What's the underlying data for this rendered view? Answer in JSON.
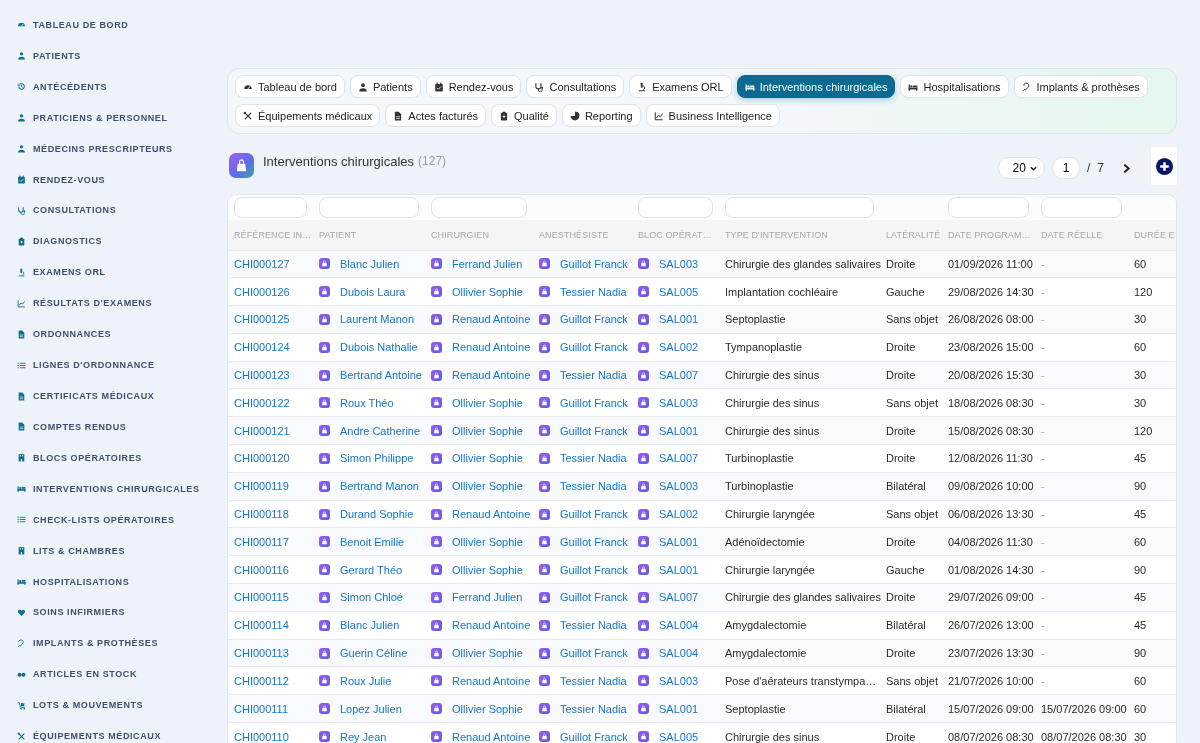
{
  "sidebar": {
    "items": [
      {
        "label": "TABLEAU DE BORD"
      },
      {
        "label": "PATIENTS"
      },
      {
        "label": "ANTÉCÉDENTS"
      },
      {
        "label": "PRATICIENS & PERSONNEL"
      },
      {
        "label": "MÉDECINS PRESCRIPTEURS"
      },
      {
        "label": "RENDEZ-VOUS"
      },
      {
        "label": "CONSULTATIONS"
      },
      {
        "label": "DIAGNOSTICS"
      },
      {
        "label": "EXAMENS ORL"
      },
      {
        "label": "RÉSULTATS D'EXAMENS"
      },
      {
        "label": "ORDONNANCES"
      },
      {
        "label": "LIGNES D'ORDONNANCE"
      },
      {
        "label": "CERTIFICATS MÉDICAUX"
      },
      {
        "label": "COMPTES RENDUS"
      },
      {
        "label": "BLOCS OPÉRATOIRES"
      },
      {
        "label": "INTERVENTIONS CHIRURGICALES"
      },
      {
        "label": "CHECK-LISTS OPÉRATOIRES"
      },
      {
        "label": "LITS & CHAMBRES"
      },
      {
        "label": "HOSPITALISATIONS"
      },
      {
        "label": "SOINS INFIRMIERS"
      },
      {
        "label": "IMPLANTS & PROTHÈSES"
      },
      {
        "label": "ARTICLES EN STOCK"
      },
      {
        "label": "LOTS & MOUVEMENTS"
      },
      {
        "label": "ÉQUIPEMENTS MÉDICAUX"
      }
    ]
  },
  "tabs": [
    {
      "label": "Tableau de bord",
      "selected": false
    },
    {
      "label": "Patients",
      "selected": false
    },
    {
      "label": "Rendez-vous",
      "selected": false
    },
    {
      "label": "Consultations",
      "selected": false
    },
    {
      "label": "Examens ORL",
      "selected": false
    },
    {
      "label": "Interventions chirurgicales",
      "selected": true
    },
    {
      "label": "Hospitalisations",
      "selected": false
    },
    {
      "label": "Implants & prothèses",
      "selected": false
    },
    {
      "label": "Équipements médicaux",
      "selected": false
    },
    {
      "label": "Actes facturés",
      "selected": false
    },
    {
      "label": "Qualité",
      "selected": false
    },
    {
      "label": "Reporting",
      "selected": false
    },
    {
      "label": "Business Intelligence",
      "selected": false
    }
  ],
  "header": {
    "title": "Interventions chirurgicales",
    "count": "(127)"
  },
  "pagination": {
    "page_size": "20",
    "page": "1",
    "separator": "/",
    "total_pages": "7"
  },
  "table": {
    "columns": [
      {
        "label": "RÉFÉRENCE IN…",
        "kind": "ref",
        "filter": true
      },
      {
        "label": "PATIENT",
        "kind": "person",
        "filter": true
      },
      {
        "label": "CHIRURGIEN",
        "kind": "person",
        "filter": true
      },
      {
        "label": "ANESTHÉSISTE",
        "kind": "person",
        "filter": false
      },
      {
        "label": "BLOC OPÉRAT…",
        "kind": "person",
        "filter": true
      },
      {
        "label": "TYPE D'INTERVENTION",
        "kind": "text",
        "filter": true
      },
      {
        "label": "LATÉRALITÉ",
        "kind": "text",
        "filter": false
      },
      {
        "label": "DATE PROGRAM…",
        "kind": "text",
        "filter": true
      },
      {
        "label": "DATE RÉELLE",
        "kind": "date",
        "filter": true
      },
      {
        "label": "DURÉE E",
        "kind": "text",
        "filter": false
      }
    ],
    "rows": [
      [
        "CHI000127",
        "Blanc Julien",
        "Ferrand Julien",
        "Guillot Franck",
        "SAL003",
        "Chirurgie des glandes salivaires",
        "Droite",
        "01/09/2026 11:00",
        "-",
        "60"
      ],
      [
        "CHI000126",
        "Dubois Laura",
        "Ollivier Sophie",
        "Tessier Nadia",
        "SAL005",
        "Implantation cochléaire",
        "Gauche",
        "29/08/2026 14:30",
        "-",
        "120"
      ],
      [
        "CHI000125",
        "Laurent Manon",
        "Renaud Antoine",
        "Guillot Franck",
        "SAL001",
        "Septoplastie",
        "Sans objet",
        "26/08/2026 08:00",
        "-",
        "30"
      ],
      [
        "CHI000124",
        "Dubois Nathalie",
        "Renaud Antoine",
        "Guillot Franck",
        "SAL002",
        "Tympanoplastie",
        "Droite",
        "23/08/2026 15:00",
        "-",
        "60"
      ],
      [
        "CHI000123",
        "Bertrand Antoine",
        "Renaud Antoine",
        "Tessier Nadia",
        "SAL007",
        "Chirurgie des sinus",
        "Droite",
        "20/08/2026 15:30",
        "-",
        "30"
      ],
      [
        "CHI000122",
        "Roux Théo",
        "Ollivier Sophie",
        "Guillot Franck",
        "SAL003",
        "Chirurgie des sinus",
        "Sans objet",
        "18/08/2026 08:30",
        "-",
        "30"
      ],
      [
        "CHI000121",
        "Andre Catherine",
        "Ollivier Sophie",
        "Guillot Franck",
        "SAL001",
        "Chirurgie des sinus",
        "Droite",
        "15/08/2026 08:30",
        "-",
        "120"
      ],
      [
        "CHI000120",
        "Simon Philippe",
        "Ollivier Sophie",
        "Tessier Nadia",
        "SAL007",
        "Turbinoplastie",
        "Droite",
        "12/08/2026 11:30",
        "-",
        "45"
      ],
      [
        "CHI000119",
        "Bertrand Manon",
        "Ollivier Sophie",
        "Tessier Nadia",
        "SAL003",
        "Turbinoplastie",
        "Bilatéral",
        "09/08/2026 10:00",
        "-",
        "90"
      ],
      [
        "CHI000118",
        "Durand Sophie",
        "Renaud Antoine",
        "Guillot Franck",
        "SAL002",
        "Chirurgie laryngée",
        "Sans objet",
        "06/08/2026 13:30",
        "-",
        "45"
      ],
      [
        "CHI000117",
        "Benoit Emilie",
        "Ollivier Sophie",
        "Guillot Franck",
        "SAL001",
        "Adénoïdectomie",
        "Droite",
        "04/08/2026 11:30",
        "-",
        "60"
      ],
      [
        "CHI000116",
        "Gerard Théo",
        "Ollivier Sophie",
        "Guillot Franck",
        "SAL001",
        "Chirurgie laryngée",
        "Gauche",
        "01/08/2026 14:30",
        "-",
        "90"
      ],
      [
        "CHI000115",
        "Simon Chloé",
        "Ferrand Julien",
        "Guillot Franck",
        "SAL007",
        "Chirurgie des glandes salivaires",
        "Droite",
        "29/07/2026 09:00",
        "-",
        "45"
      ],
      [
        "CHI000114",
        "Blanc Julien",
        "Renaud Antoine",
        "Tessier Nadia",
        "SAL004",
        "Amygdalectomie",
        "Bilatéral",
        "26/07/2026 13:00",
        "-",
        "45"
      ],
      [
        "CHI000113",
        "Guerin Céline",
        "Ollivier Sophie",
        "Guillot Franck",
        "SAL004",
        "Amygdalectomie",
        "Droite",
        "23/07/2026 13:30",
        "-",
        "90"
      ],
      [
        "CHI000112",
        "Roux Julie",
        "Renaud Antoine",
        "Tessier Nadia",
        "SAL003",
        "Pose d'aérateurs transtympa…",
        "Sans objet",
        "21/07/2026 10:00",
        "-",
        "60"
      ],
      [
        "CHI000111",
        "Lopez Julien",
        "Ollivier Sophie",
        "Tessier Nadia",
        "SAL001",
        "Septoplastie",
        "Bilatéral",
        "15/07/2026 09:00",
        "15/07/2026 09:00",
        "60"
      ],
      [
        "CHI000110",
        "Rey Jean",
        "Renaud Antoine",
        "Guillot Franck",
        "SAL005",
        "Chirurgie des sinus",
        "Droite",
        "08/07/2026 08:30",
        "08/07/2026 08:30",
        "30"
      ]
    ]
  }
}
